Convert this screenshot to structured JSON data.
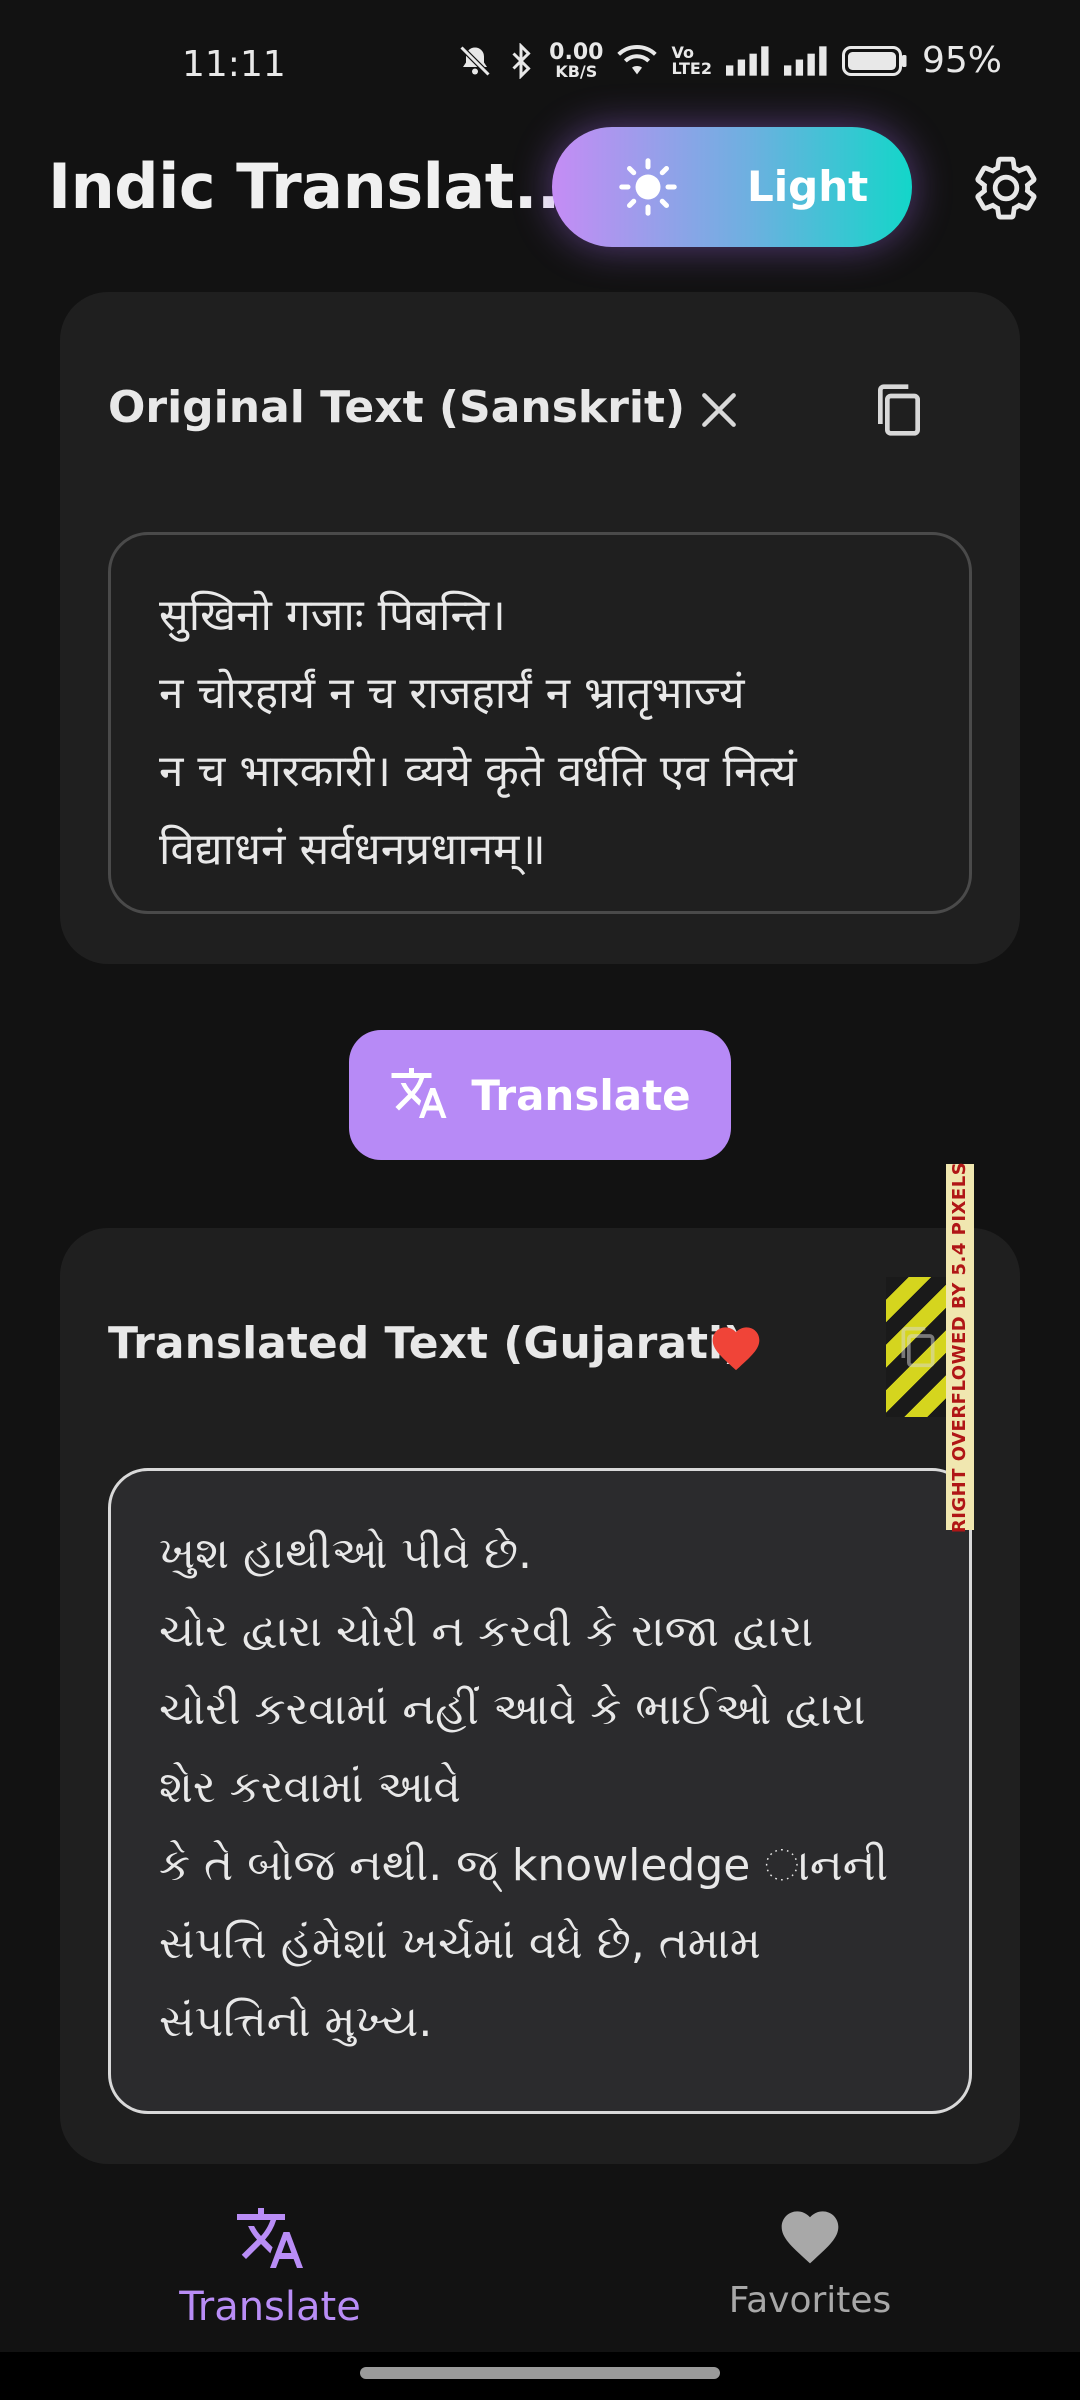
{
  "status_bar": {
    "time": "11:11",
    "net_speed_value": "0.00",
    "net_speed_unit": "KB/S",
    "volte_top": "Vo",
    "volte_bottom": "LTE2",
    "battery": "95%",
    "icons": [
      "mute-bell-icon",
      "bluetooth-icon",
      "wifi-icon",
      "signal-icon",
      "signal-icon",
      "battery-icon"
    ]
  },
  "app_bar": {
    "title": "Indic Translat...",
    "theme_toggle_label": "Light",
    "theme_toggle_colors": [
      "#c58cf5",
      "#13d6c9"
    ],
    "theme_toggle_icon": "sun-icon",
    "settings_icon": "gear-icon"
  },
  "original": {
    "title": "Original Text (Sanskrit)",
    "clear_icon": "close-icon",
    "copy_icon": "copy-icon",
    "text": "सुखिनो गजाः पिबन्ति।\n न चोरहार्यं न च राजहार्यं न भ्रातृभाज्यं\nन च भारकारी। व्यये कृते वर्धति एव नित्यं\nविद्याधनं सर्वधनप्रधानम्॥"
  },
  "translate_button": {
    "label": "Translate",
    "icon": "translate-icon",
    "color": "#b78af6"
  },
  "translated": {
    "title": "Translated Text (Gujarati)",
    "favorite_icon": "heart-icon",
    "favorite_color": "#f04438",
    "copy_icon": "copy-icon",
    "overflow_warning": "RIGHT OVERFLOWED BY 5.4 PIXELS",
    "text": "ખુશ હાથીઓ પીવે છે.\n ચોર દ્વારા ચોરી ન કરવી કે રાજા દ્વારા\nચોરી કરવામાં નહીં આવે કે ભાઈઓ દ્વારા\nશેર કરવામાં આવે\nકે તે બોજ નથી. જ્ knowledge ાનની\nસંપત્તિ હંમેશાં ખર્ચમાં વધે છે, તમામ\nસંપત્તિનો મુખ્ય."
  },
  "bottom_nav": {
    "items": [
      {
        "label": "Translate",
        "icon": "translate-icon",
        "active": true,
        "color": "#b98df6"
      },
      {
        "label": "Favorites",
        "icon": "heart-icon",
        "active": false,
        "color": "#a8a8a8"
      }
    ]
  }
}
